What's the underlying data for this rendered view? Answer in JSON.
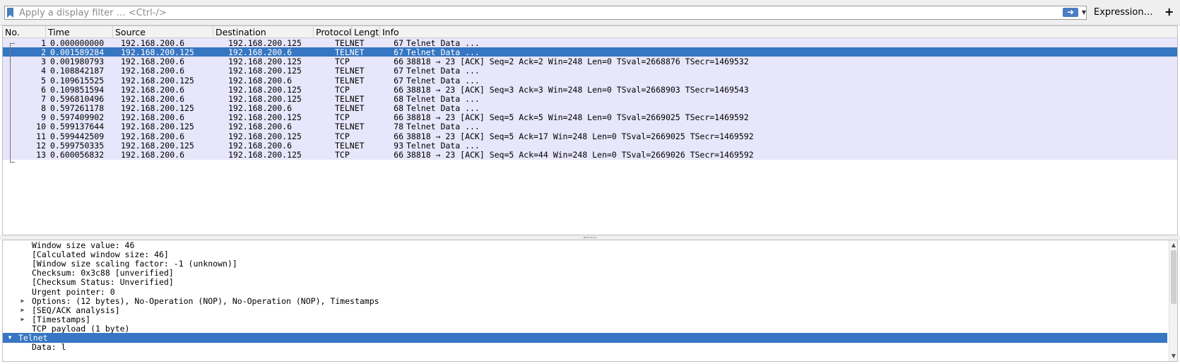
{
  "filter": {
    "placeholder": "Apply a display filter … <Ctrl-/>",
    "apply_icon": "arrow-right-icon",
    "expression_label": "Expression…",
    "add_label": "+"
  },
  "packet_list": {
    "columns": [
      "No.",
      "Time",
      "Source",
      "Destination",
      "Protocol",
      "Length",
      "Info"
    ],
    "rows": [
      {
        "no": "1",
        "time": "0.000000000",
        "src": "192.168.200.6",
        "dst": "192.168.200.125",
        "proto": "TELNET",
        "len": "67",
        "info": "Telnet Data ..."
      },
      {
        "no": "2",
        "time": "0.001589284",
        "src": "192.168.200.125",
        "dst": "192.168.200.6",
        "proto": "TELNET",
        "len": "67",
        "info": "Telnet Data ..."
      },
      {
        "no": "3",
        "time": "0.001980793",
        "src": "192.168.200.6",
        "dst": "192.168.200.125",
        "proto": "TCP",
        "len": "66",
        "info": "38818 → 23 [ACK] Seq=2 Ack=2 Win=248 Len=0 TSval=2668876 TSecr=1469532"
      },
      {
        "no": "4",
        "time": "0.108842187",
        "src": "192.168.200.6",
        "dst": "192.168.200.125",
        "proto": "TELNET",
        "len": "67",
        "info": "Telnet Data ..."
      },
      {
        "no": "5",
        "time": "0.109615525",
        "src": "192.168.200.125",
        "dst": "192.168.200.6",
        "proto": "TELNET",
        "len": "67",
        "info": "Telnet Data ..."
      },
      {
        "no": "6",
        "time": "0.109851594",
        "src": "192.168.200.6",
        "dst": "192.168.200.125",
        "proto": "TCP",
        "len": "66",
        "info": "38818 → 23 [ACK] Seq=3 Ack=3 Win=248 Len=0 TSval=2668903 TSecr=1469543"
      },
      {
        "no": "7",
        "time": "0.596810496",
        "src": "192.168.200.6",
        "dst": "192.168.200.125",
        "proto": "TELNET",
        "len": "68",
        "info": "Telnet Data ..."
      },
      {
        "no": "8",
        "time": "0.597261178",
        "src": "192.168.200.125",
        "dst": "192.168.200.6",
        "proto": "TELNET",
        "len": "68",
        "info": "Telnet Data ..."
      },
      {
        "no": "9",
        "time": "0.597409902",
        "src": "192.168.200.6",
        "dst": "192.168.200.125",
        "proto": "TCP",
        "len": "66",
        "info": "38818 → 23 [ACK] Seq=5 Ack=5 Win=248 Len=0 TSval=2669025 TSecr=1469592"
      },
      {
        "no": "10",
        "time": "0.599137644",
        "src": "192.168.200.125",
        "dst": "192.168.200.6",
        "proto": "TELNET",
        "len": "78",
        "info": "Telnet Data ..."
      },
      {
        "no": "11",
        "time": "0.599442509",
        "src": "192.168.200.6",
        "dst": "192.168.200.125",
        "proto": "TCP",
        "len": "66",
        "info": "38818 → 23 [ACK] Seq=5 Ack=17 Win=248 Len=0 TSval=2669025 TSecr=1469592"
      },
      {
        "no": "12",
        "time": "0.599750335",
        "src": "192.168.200.125",
        "dst": "192.168.200.6",
        "proto": "TELNET",
        "len": "93",
        "info": "Telnet Data ..."
      },
      {
        "no": "13",
        "time": "0.600056832",
        "src": "192.168.200.6",
        "dst": "192.168.200.125",
        "proto": "TCP",
        "len": "66",
        "info": "38818 → 23 [ACK] Seq=5 Ack=44 Win=248 Len=0 TSval=2669026 TSecr=1469592"
      }
    ],
    "selected_row": "2"
  },
  "details": {
    "rows": [
      {
        "text": "Window size value: 46",
        "expander": ""
      },
      {
        "text": "[Calculated window size: 46]",
        "expander": ""
      },
      {
        "text": "[Window size scaling factor: -1 (unknown)]",
        "expander": ""
      },
      {
        "text": "Checksum: 0x3c88 [unverified]",
        "expander": ""
      },
      {
        "text": "[Checksum Status: Unverified]",
        "expander": ""
      },
      {
        "text": "Urgent pointer: 0",
        "expander": ""
      },
      {
        "text": "Options: (12 bytes), No-Operation (NOP), No-Operation (NOP), Timestamps",
        "expander": "collapsed"
      },
      {
        "text": "[SEQ/ACK analysis]",
        "expander": "collapsed"
      },
      {
        "text": "[Timestamps]",
        "expander": "collapsed"
      },
      {
        "text": "TCP payload (1 byte)",
        "expander": ""
      },
      {
        "text": "Telnet",
        "expander": "expanded",
        "selected": true
      },
      {
        "text": "Data: l",
        "expander": ""
      }
    ]
  },
  "colors": {
    "selection": "#3676c2",
    "tcp_row": "#e7e6fa"
  }
}
